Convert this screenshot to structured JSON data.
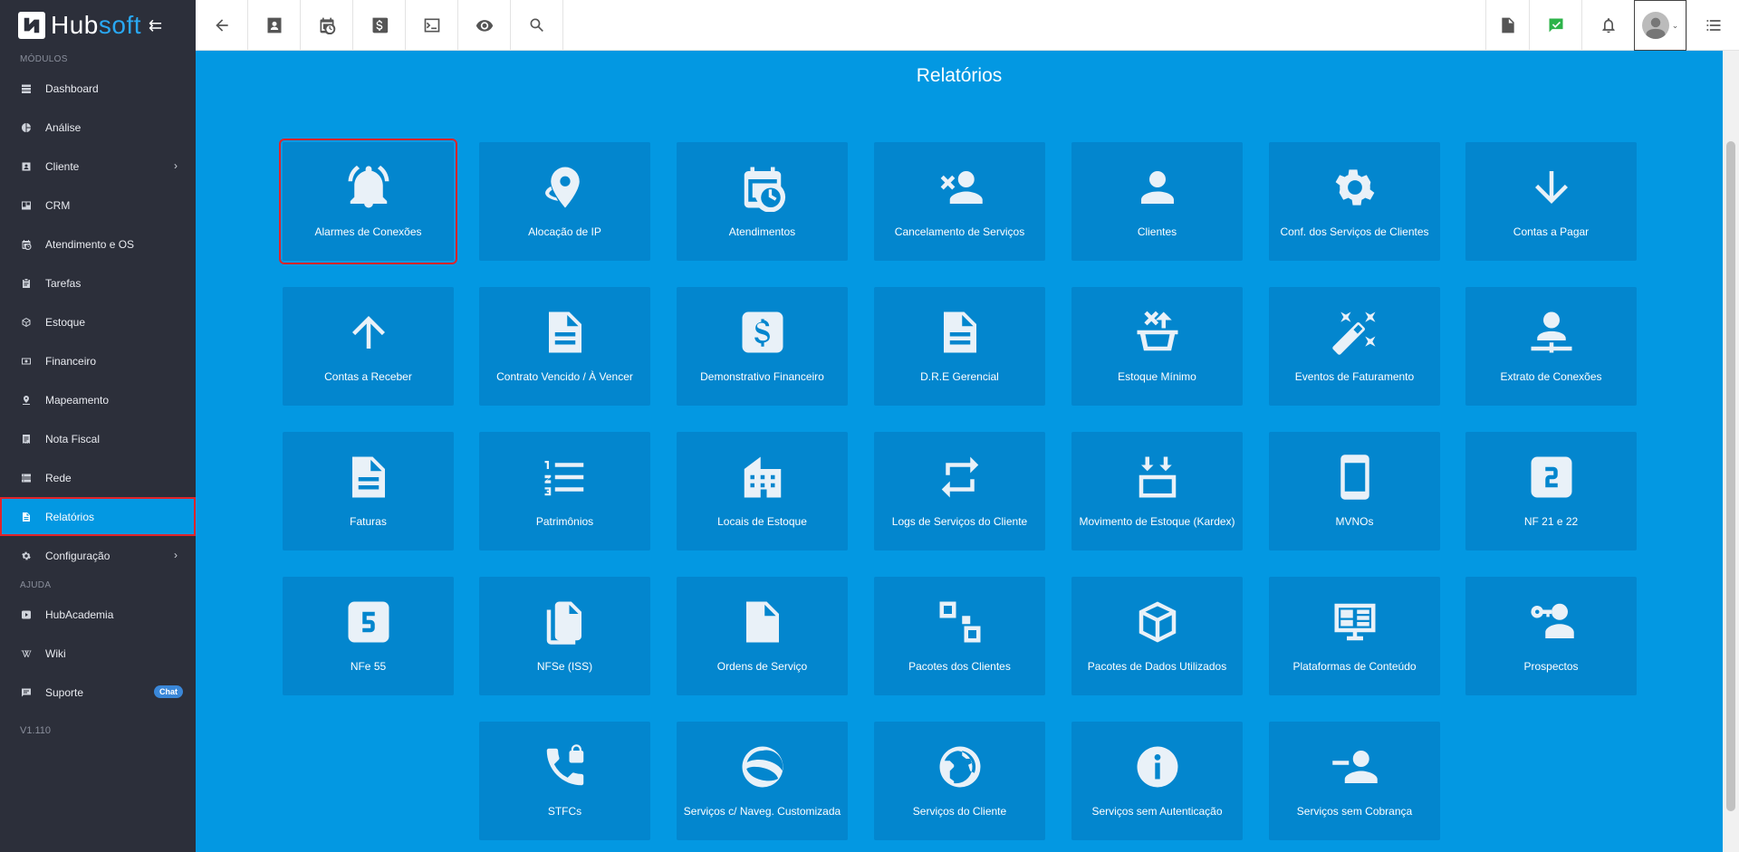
{
  "brand": {
    "name_a": "Hub",
    "name_b": "soft",
    "collapse_glyph": "⇇"
  },
  "sidebar": {
    "section_modules": "MÓDULOS",
    "section_help": "AJUDA",
    "modules": [
      {
        "label": "Dashboard",
        "icon": "dashboard-icon"
      },
      {
        "label": "Análise",
        "icon": "pie-chart-icon"
      },
      {
        "label": "Cliente",
        "icon": "contact-card-icon",
        "has_submenu": true
      },
      {
        "label": "CRM",
        "icon": "crm-board-icon"
      },
      {
        "label": "Atendimento e OS",
        "icon": "calendar-clock-icon"
      },
      {
        "label": "Tarefas",
        "icon": "task-board-icon"
      },
      {
        "label": "Estoque",
        "icon": "box-icon"
      },
      {
        "label": "Financeiro",
        "icon": "money-icon"
      },
      {
        "label": "Mapeamento",
        "icon": "map-pin-icon"
      },
      {
        "label": "Nota Fiscal",
        "icon": "receipt-icon"
      },
      {
        "label": "Rede",
        "icon": "server-icon"
      },
      {
        "label": "Relatórios",
        "icon": "document-icon",
        "active": true
      },
      {
        "label": "Configuração",
        "icon": "gear-icon",
        "has_submenu": true
      }
    ],
    "help": [
      {
        "label": "HubAcademia",
        "icon": "youtube-icon"
      },
      {
        "label": "Wiki",
        "icon": "wikipedia-icon"
      },
      {
        "label": "Suporte",
        "icon": "chat-icon",
        "badge": "Chat"
      }
    ],
    "version": "V1.110"
  },
  "topbar": {
    "left_icons": [
      "back-arrow-icon",
      "contact-icon",
      "calendar-clock-icon",
      "dollar-icon",
      "terminal-icon",
      "eye-icon",
      "search-icon"
    ],
    "right_icons": [
      "pdf-icon",
      "check-message-icon",
      "bell-icon",
      "avatar",
      "list-icon"
    ]
  },
  "main": {
    "title": "Relatórios",
    "tiles": [
      {
        "label": "Alarmes de Conexões",
        "icon": "alarm-bell-icon",
        "highlighted": true
      },
      {
        "label": "Alocação de IP",
        "icon": "location-pin-icon"
      },
      {
        "label": "Atendimentos",
        "icon": "calendar-clock-icon"
      },
      {
        "label": "Cancelamento de Serviços",
        "icon": "person-remove-icon"
      },
      {
        "label": "Clientes",
        "icon": "person-icon"
      },
      {
        "label": "Conf. dos Serviços de Clientes",
        "icon": "gear-icon"
      },
      {
        "label": "Contas a Pagar",
        "icon": "arrow-down-icon"
      },
      {
        "label": "Contas a Receber",
        "icon": "arrow-up-icon"
      },
      {
        "label": "Contrato Vencido / À Vencer",
        "icon": "document-icon"
      },
      {
        "label": "Demonstrativo Financeiro",
        "icon": "dollar-box-icon"
      },
      {
        "label": "D.R.E Gerencial",
        "icon": "document-icon"
      },
      {
        "label": "Estoque Mínimo",
        "icon": "basket-up-icon"
      },
      {
        "label": "Eventos de Faturamento",
        "icon": "magic-wand-icon"
      },
      {
        "label": "Extrato de Conexões",
        "icon": "person-network-icon"
      },
      {
        "label": "Faturas",
        "icon": "document-icon"
      },
      {
        "label": "Patrimônios",
        "icon": "numbered-list-icon"
      },
      {
        "label": "Locais de Estoque",
        "icon": "building-icon"
      },
      {
        "label": "Logs de Serviços do Cliente",
        "icon": "repeat-icon"
      },
      {
        "label": "Movimento de Estoque (Kardex)",
        "icon": "box-arrows-icon"
      },
      {
        "label": "MVNOs",
        "icon": "smartphone-icon"
      },
      {
        "label": "NF 21 e 22",
        "icon": "numeric-2-box-icon"
      },
      {
        "label": "NFe 55",
        "icon": "numeric-5-box-icon"
      },
      {
        "label": "NFSe (ISS)",
        "icon": "file-multiple-icon"
      },
      {
        "label": "Ordens de Serviço",
        "icon": "file-search-icon"
      },
      {
        "label": "Pacotes dos Clientes",
        "icon": "package-squares-icon"
      },
      {
        "label": "Pacotes de Dados Utilizados",
        "icon": "cube-open-icon"
      },
      {
        "label": "Plataformas de Conteúdo",
        "icon": "monitor-dashboard-icon"
      },
      {
        "label": "Prospectos",
        "icon": "person-key-icon"
      },
      {
        "label": "STFCs",
        "icon": "phone-lock-icon"
      },
      {
        "label": "Serviços c/ Naveg. Customizada",
        "icon": "planet-icon"
      },
      {
        "label": "Serviços do Cliente",
        "icon": "globe-icon"
      },
      {
        "label": "Serviços sem Autenticação",
        "icon": "info-icon"
      },
      {
        "label": "Serviços sem Cobrança",
        "icon": "person-minus-icon"
      }
    ]
  }
}
